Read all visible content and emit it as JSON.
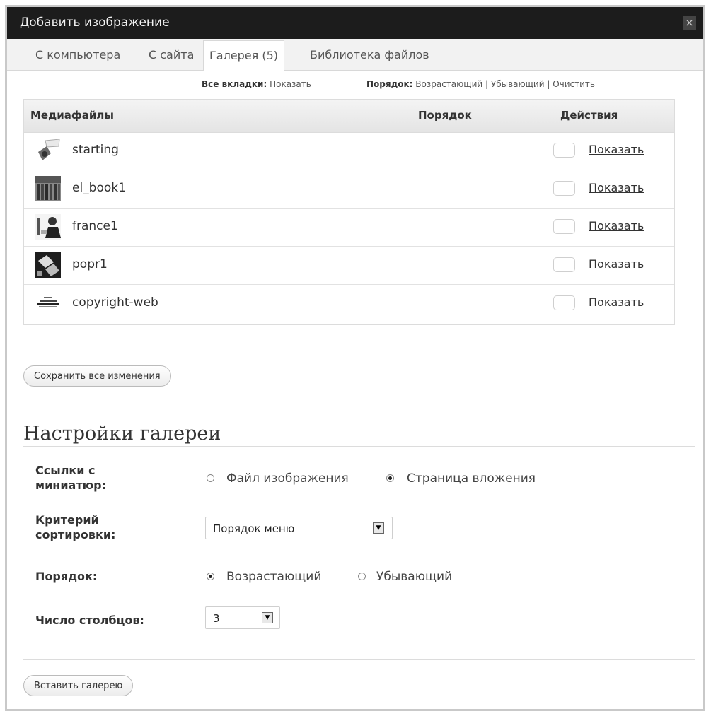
{
  "window": {
    "title": "Добавить изображение",
    "close_glyph": "×"
  },
  "tabs": [
    {
      "label": "С компьютера"
    },
    {
      "label": "С сайта"
    },
    {
      "label": "Галерея (5)"
    },
    {
      "label": "Библиотека файлов"
    }
  ],
  "toplinks": {
    "all_tabs_label": "Все вкладки:",
    "all_tabs_link": "Показать",
    "order_label": "Порядок:",
    "asc": "Возрастающий",
    "sep1": "|",
    "desc": "Убывающий",
    "sep2": "|",
    "clear": "Очистить"
  },
  "media_table": {
    "headers": {
      "media": "Медиафайлы",
      "order": "Порядок",
      "actions": "Действия"
    },
    "rows": [
      {
        "name": "starting",
        "action": "Показать",
        "thumb_icon": "image-thumbnail-icon"
      },
      {
        "name": "el_book1",
        "action": "Показать",
        "thumb_icon": "image-thumbnail-icon"
      },
      {
        "name": "france1",
        "action": "Показать",
        "thumb_icon": "image-thumbnail-icon"
      },
      {
        "name": "popr1",
        "action": "Показать",
        "thumb_icon": "image-thumbnail-icon"
      },
      {
        "name": "copyright-web",
        "action": "Показать",
        "thumb_icon": "image-thumbnail-icon"
      }
    ]
  },
  "save_button": "Сохранить все изменения",
  "gallery_settings": {
    "title": "Настройки галереи",
    "links_label_1": "Ссылки с",
    "links_label_2": "миниатюр:",
    "link_options": {
      "file": "Файл изображения",
      "attachment": "Страница вложения",
      "selected": "attachment"
    },
    "sort_label_1": "Критерий",
    "sort_label_2": "сортировки:",
    "sort_value": "Порядок меню",
    "order_label": "Порядок:",
    "order_options": {
      "asc": "Возрастающий",
      "desc": "Убывающий",
      "selected": "asc"
    },
    "columns_label": "Число столбцов:",
    "columns_value": "3"
  },
  "insert_button": "Вставить галерею"
}
